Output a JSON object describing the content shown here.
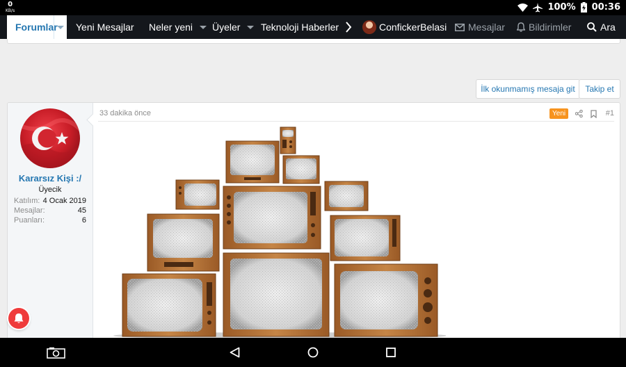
{
  "status_bar": {
    "net_speed": "0",
    "net_unit": "KB/s",
    "battery": "100%",
    "time": "00:36",
    "icons": [
      "wifi-icon",
      "airplane-icon",
      "battery-charging-icon"
    ]
  },
  "nav": {
    "active_tab": "Forumlar",
    "items": [
      {
        "label": "Yeni Mesajlar"
      },
      {
        "label": "Neler yeni"
      },
      {
        "label": "Üyeler"
      },
      {
        "label": "Teknoloji Haberleri"
      }
    ],
    "user": "ConfickerBelasi",
    "messages": "Mesajlar",
    "alerts": "Bildirimler",
    "search": "Ara"
  },
  "actions": {
    "first_unread": "İlk okunmamış mesaja git",
    "follow": "Takip et"
  },
  "post": {
    "author": "Kararsız Kişi :/",
    "user_title": "Üyecik",
    "stats": [
      {
        "label": "Katılım:",
        "value": "4 Ocak 2019"
      },
      {
        "label": "Mesajlar:",
        "value": "45"
      },
      {
        "label": "Puanları:",
        "value": "6"
      }
    ],
    "time": "33 dakika önce",
    "badge": "Yeni",
    "number": "#1"
  },
  "colors": {
    "accent": "#2577b1",
    "navbar": "#14171c",
    "badge": "#f7931e",
    "wood": "#b5733a"
  }
}
